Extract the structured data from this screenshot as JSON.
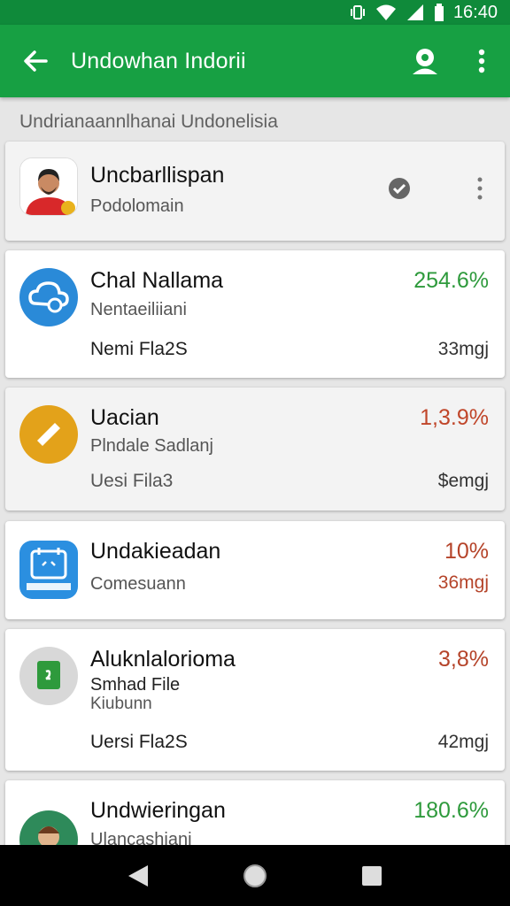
{
  "status_bar": {
    "time": "16:40"
  },
  "app_bar": {
    "title": "Undowhan Indorii"
  },
  "section": {
    "title": "Undrianaannlhanai Undonelisia"
  },
  "profile": {
    "name": "Uncbarllispan",
    "subtitle": "Podolomain"
  },
  "items": [
    {
      "title": "Chal Nallama",
      "subtitle": "Nentaeiliiani",
      "version": "Nemi Fla2S",
      "percent": "254.6%",
      "size": "33mgj",
      "percent_color": "#2e9a3c"
    },
    {
      "title": "Uacian",
      "subtitle": "Plndale Sadlanj",
      "version": "Uesi Fila3",
      "percent": "1,3.9%",
      "size": "$emgj",
      "percent_color": "#c0462a"
    },
    {
      "title": "Undakieadan",
      "subtitle": "Comesuann",
      "percent": "10%",
      "size": "36mgj",
      "percent_color": "#b5442a"
    },
    {
      "title": "Aluknlalorioma",
      "subtitle": "Smhad File",
      "subtitle2": "Kiubunn",
      "version": "Uersi Fla2S",
      "percent": "3,8%",
      "size": "42mgj",
      "percent_color": "#b5442a"
    },
    {
      "title": "Undwieringan",
      "subtitle": "Ulancashiani",
      "percent": "180.6%",
      "percent_color": "#2e9a3c"
    }
  ],
  "icons": {
    "item1": "cloud-sync-icon",
    "item2": "ticket-icon",
    "item3": "calendar-app-icon",
    "item4": "file-app-icon",
    "item5": "person-avatar-icon"
  },
  "colors": {
    "appbar": "#17a043",
    "statusbar": "#0f8a3a",
    "green_text": "#2e9a3c",
    "red_text": "#c0462a"
  }
}
